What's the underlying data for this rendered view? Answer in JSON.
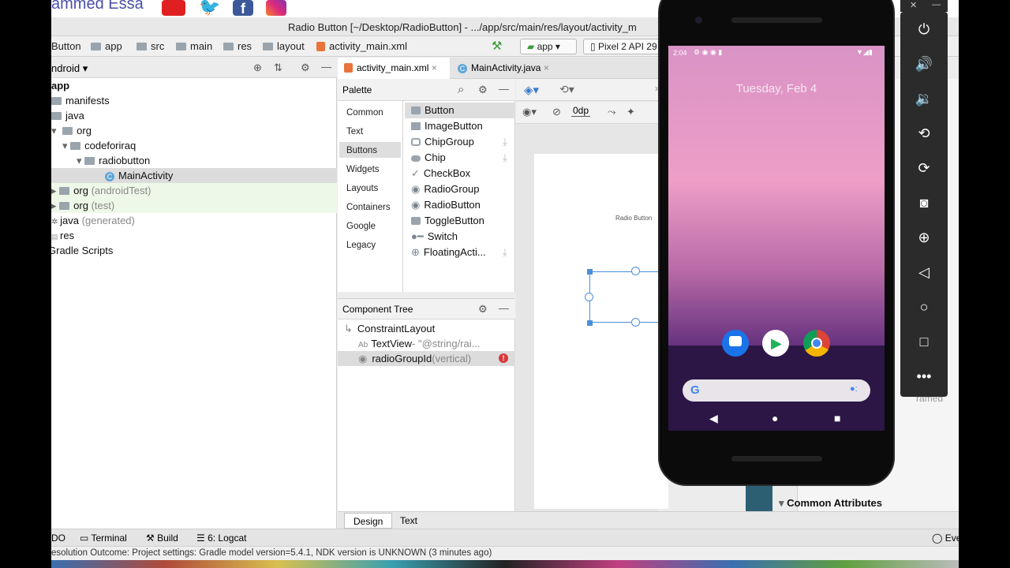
{
  "banner": {
    "brand": "ammed Essa"
  },
  "window": {
    "title": "Radio Button [~/Desktop/RadioButton] - .../app/src/main/res/layout/activity_m"
  },
  "breadcrumbs": [
    "Button",
    "app",
    "src",
    "main",
    "res",
    "layout",
    "activity_main.xml"
  ],
  "run": {
    "config": "app",
    "device": "Pixel 2 API 29"
  },
  "project": {
    "view": "ndroid",
    "tree": [
      {
        "label": "app",
        "extra": ""
      },
      {
        "label": "manifests",
        "extra": ""
      },
      {
        "label": "java",
        "extra": ""
      },
      {
        "label": "org",
        "extra": ""
      },
      {
        "label": "codeforiraq",
        "extra": ""
      },
      {
        "label": "radiobutton",
        "extra": ""
      },
      {
        "label": "MainActivity",
        "extra": ""
      },
      {
        "label": "org",
        "extra": "(androidTest)"
      },
      {
        "label": "org",
        "extra": "(test)"
      },
      {
        "label": "java",
        "extra": "(generated)"
      },
      {
        "label": "res",
        "extra": ""
      },
      {
        "label": "Gradle Scripts",
        "extra": ""
      }
    ]
  },
  "editor": {
    "tabs": [
      "activity_main.xml",
      "MainActivity.java"
    ],
    "margin": "0dp",
    "preview_label": "Radio Button"
  },
  "palette": {
    "title": "Palette",
    "categories": [
      "Common",
      "Text",
      "Buttons",
      "Widgets",
      "Layouts",
      "Containers",
      "Google",
      "Legacy"
    ],
    "items": [
      "Button",
      "ImageButton",
      "ChipGroup",
      "Chip",
      "CheckBox",
      "RadioGroup",
      "RadioButton",
      "ToggleButton",
      "Switch",
      "FloatingActi..."
    ]
  },
  "component_tree": {
    "title": "Component Tree",
    "rows": [
      {
        "label": "ConstraintLayout",
        "extra": ""
      },
      {
        "label": "TextView",
        "extra": "- \"@string/rai..."
      },
      {
        "label": "radioGroupId",
        "extra": "(vertical)"
      }
    ]
  },
  "design_tabs": [
    "Design",
    "Text"
  ],
  "bottom_tools": [
    "DO",
    "Terminal",
    "Build",
    "6: Logcat",
    "Eve"
  ],
  "status": "esolution Outcome: Project settings: Gradle model version=5.4.1, NDK version is UNKNOWN (3 minutes ago)",
  "attributes": {
    "common": "Common Attributes",
    "partial": "ramed"
  },
  "phone": {
    "time": "2:04",
    "date": "Tuesday, Feb 4"
  }
}
